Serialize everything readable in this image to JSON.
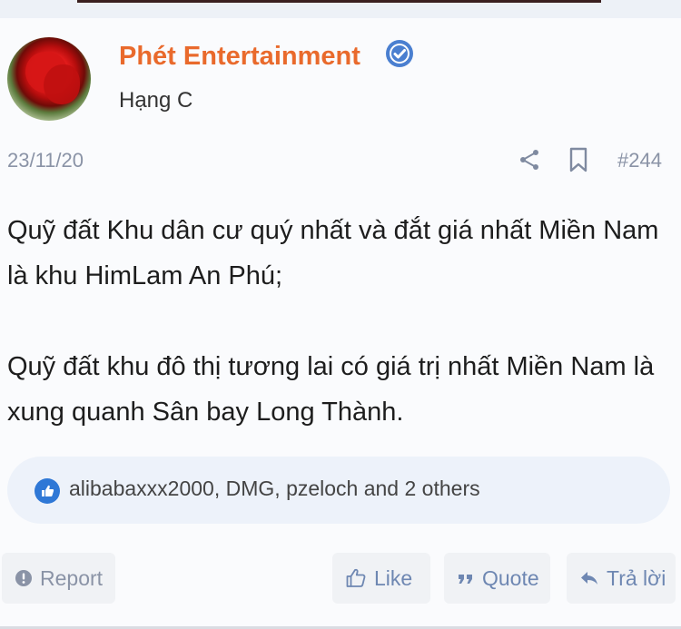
{
  "post": {
    "author": "Phét Entertainment",
    "rank": "Hạng C",
    "date": "23/11/20",
    "post_number": "#244",
    "paragraphs": [
      "Quỹ đất Khu dân cư quý nhất và đắt giá nhất Miền Nam là khu HimLam An Phú;",
      "Quỹ đất khu đô thị tương lai có giá trị nhất Miền Nam là xung quanh Sân bay Long Thành."
    ],
    "reactions": "alibabaxxx2000, DMG, pzeloch and 2 others"
  },
  "actions": {
    "report": "Report",
    "like": "Like",
    "quote": "Quote",
    "reply": "Trả lời"
  },
  "icons": [
    "avatar",
    "verified-badge-icon",
    "share-icon",
    "bookmark-icon",
    "thumbs-up-icon",
    "alert-icon",
    "quote-icon",
    "reply-arrow-icon"
  ],
  "colors": {
    "username": "#e96a2c",
    "accent": "#2f78d6",
    "muted": "#8a93a6",
    "reaction_bg": "#edf2fa"
  }
}
